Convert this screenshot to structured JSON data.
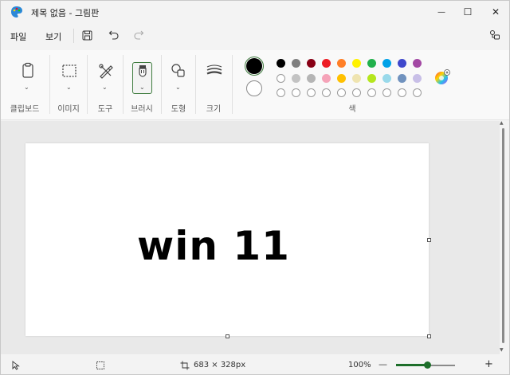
{
  "window": {
    "title": "제목 없음 - 그림판",
    "minimize_glyph": "—",
    "maximize_glyph": "☐",
    "close_glyph": "✕"
  },
  "menu": {
    "file_label": "파일",
    "view_label": "보기"
  },
  "ribbon": {
    "groups": [
      {
        "label": "클립보드",
        "icon": "clipboard-icon"
      },
      {
        "label": "이미지",
        "icon": "select-rectangle-icon"
      },
      {
        "label": "도구",
        "icon": "tools-icon"
      },
      {
        "label": "브러시",
        "icon": "brush-icon"
      },
      {
        "label": "도형",
        "icon": "shapes-icon"
      },
      {
        "label": "크기",
        "icon": "line-size-icon"
      }
    ],
    "colors_label": "색"
  },
  "colors": {
    "primary": "#000000",
    "secondary": "#ffffff",
    "row1": [
      "#000000",
      "#7f7f7f",
      "#880015",
      "#ed1c24",
      "#ff7f27",
      "#fff200",
      "#22b14c",
      "#00a2e8",
      "#3f48cc",
      "#a349a4"
    ],
    "row2": [
      "#ffffff",
      "#c3c3c3",
      "#b5b5b5",
      "#f5a3b8",
      "#ffc000",
      "#efe4b0",
      "#b5e61d",
      "#99d9ea",
      "#7092be",
      "#c8bfe7"
    ],
    "row3_empty_count": 10,
    "accent": "#1d6e2a"
  },
  "canvas": {
    "text": "win 11"
  },
  "status": {
    "canvas_size": "683 × 328px",
    "zoom": "100%",
    "zoom_out": "—",
    "zoom_in": "+"
  }
}
